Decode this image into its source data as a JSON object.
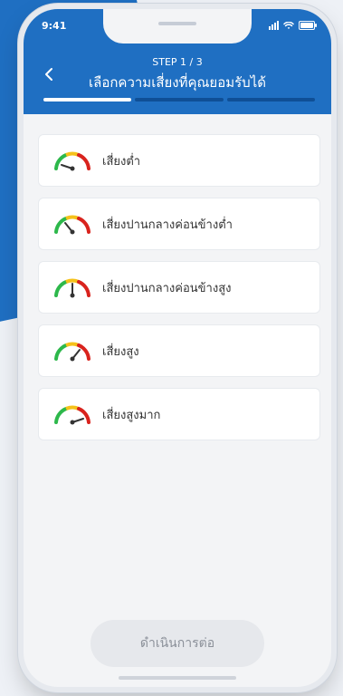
{
  "status": {
    "time": "9:41"
  },
  "header": {
    "step": "STEP 1 / 3",
    "title": "เลือกความเสี่ยงที่คุณยอมรับได้",
    "progress": {
      "current": 1,
      "total": 3
    }
  },
  "options": [
    {
      "label": "เสี่ยงต่ำ",
      "icon": "risk-gauge-low-icon"
    },
    {
      "label": "เสี่ยงปานกลางค่อนข้างต่ำ",
      "icon": "risk-gauge-medium-low-icon"
    },
    {
      "label": "เสี่ยงปานกลางค่อนข้างสูง",
      "icon": "risk-gauge-medium-high-icon"
    },
    {
      "label": "เสี่ยงสูง",
      "icon": "risk-gauge-high-icon"
    },
    {
      "label": "เสี่ยงสูงมาก",
      "icon": "risk-gauge-very-high-icon"
    }
  ],
  "cta": {
    "label": "ดำเนินการต่อ",
    "state": "disabled"
  },
  "colors": {
    "brand": "#1f6fc2",
    "gauge_green": "#2db84b",
    "gauge_yellow": "#f5c21a",
    "gauge_red": "#d9231d",
    "cta_bg": "#e6e8ec"
  }
}
